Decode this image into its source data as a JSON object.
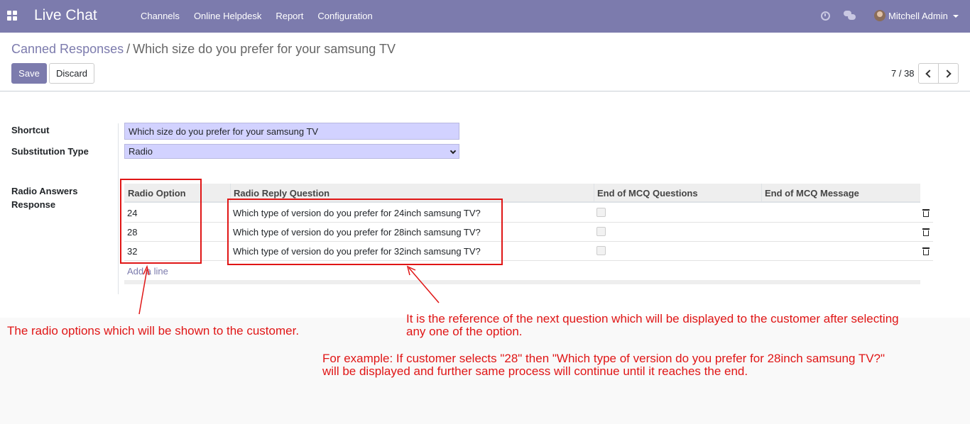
{
  "navbar": {
    "brand": "Live Chat",
    "menu": [
      "Channels",
      "Online Helpdesk",
      "Report",
      "Configuration"
    ],
    "user_name": "Mitchell Admin",
    "icons": [
      "apps-icon",
      "clock-icon",
      "chat-icon",
      "avatar",
      "caret-down-icon"
    ]
  },
  "control": {
    "breadcrumb_parent": "Canned Responses",
    "breadcrumb_separator": "/",
    "breadcrumb_current": "Which size do you prefer for your samsung TV",
    "save_label": "Save",
    "discard_label": "Discard",
    "pager": "7 / 38"
  },
  "form": {
    "shortcut_label": "Shortcut",
    "shortcut_value": "Which size do you prefer for your samsung TV",
    "substitution_type_label": "Substitution Type",
    "substitution_type_value": "Radio",
    "radio_answers_label_line1": "Radio Answers",
    "radio_answers_label_line2": "Response"
  },
  "table": {
    "columns": [
      "Radio Option",
      "Radio Reply Question",
      "End of MCQ Questions",
      "End of MCQ Message"
    ],
    "rows": [
      {
        "option": "24",
        "question": "Which type of version do you prefer for 24inch samsung TV?"
      },
      {
        "option": "28",
        "question": "Which type of version do you prefer for 28inch samsung TV?"
      },
      {
        "option": "32",
        "question": "Which type of version do you prefer for 32inch samsung TV?"
      }
    ],
    "add_line": "Add a line"
  },
  "annotations": {
    "left_note": "The radio options which will be shown to the customer.",
    "right_note_line1": "It is the reference of the next question which will be displayed to the customer after selecting",
    "right_note_line2": "any one of the option.",
    "example_line1": "For example: If customer selects \"28\" then \"Which type of version do you prefer for 28inch samsung TV?\"",
    "example_line2": "will be displayed and further same process will continue until it reaches the end.",
    "color": "#e01616"
  },
  "colors": {
    "brand": "#7c7bad",
    "input_bg": "#d2d2ff"
  }
}
